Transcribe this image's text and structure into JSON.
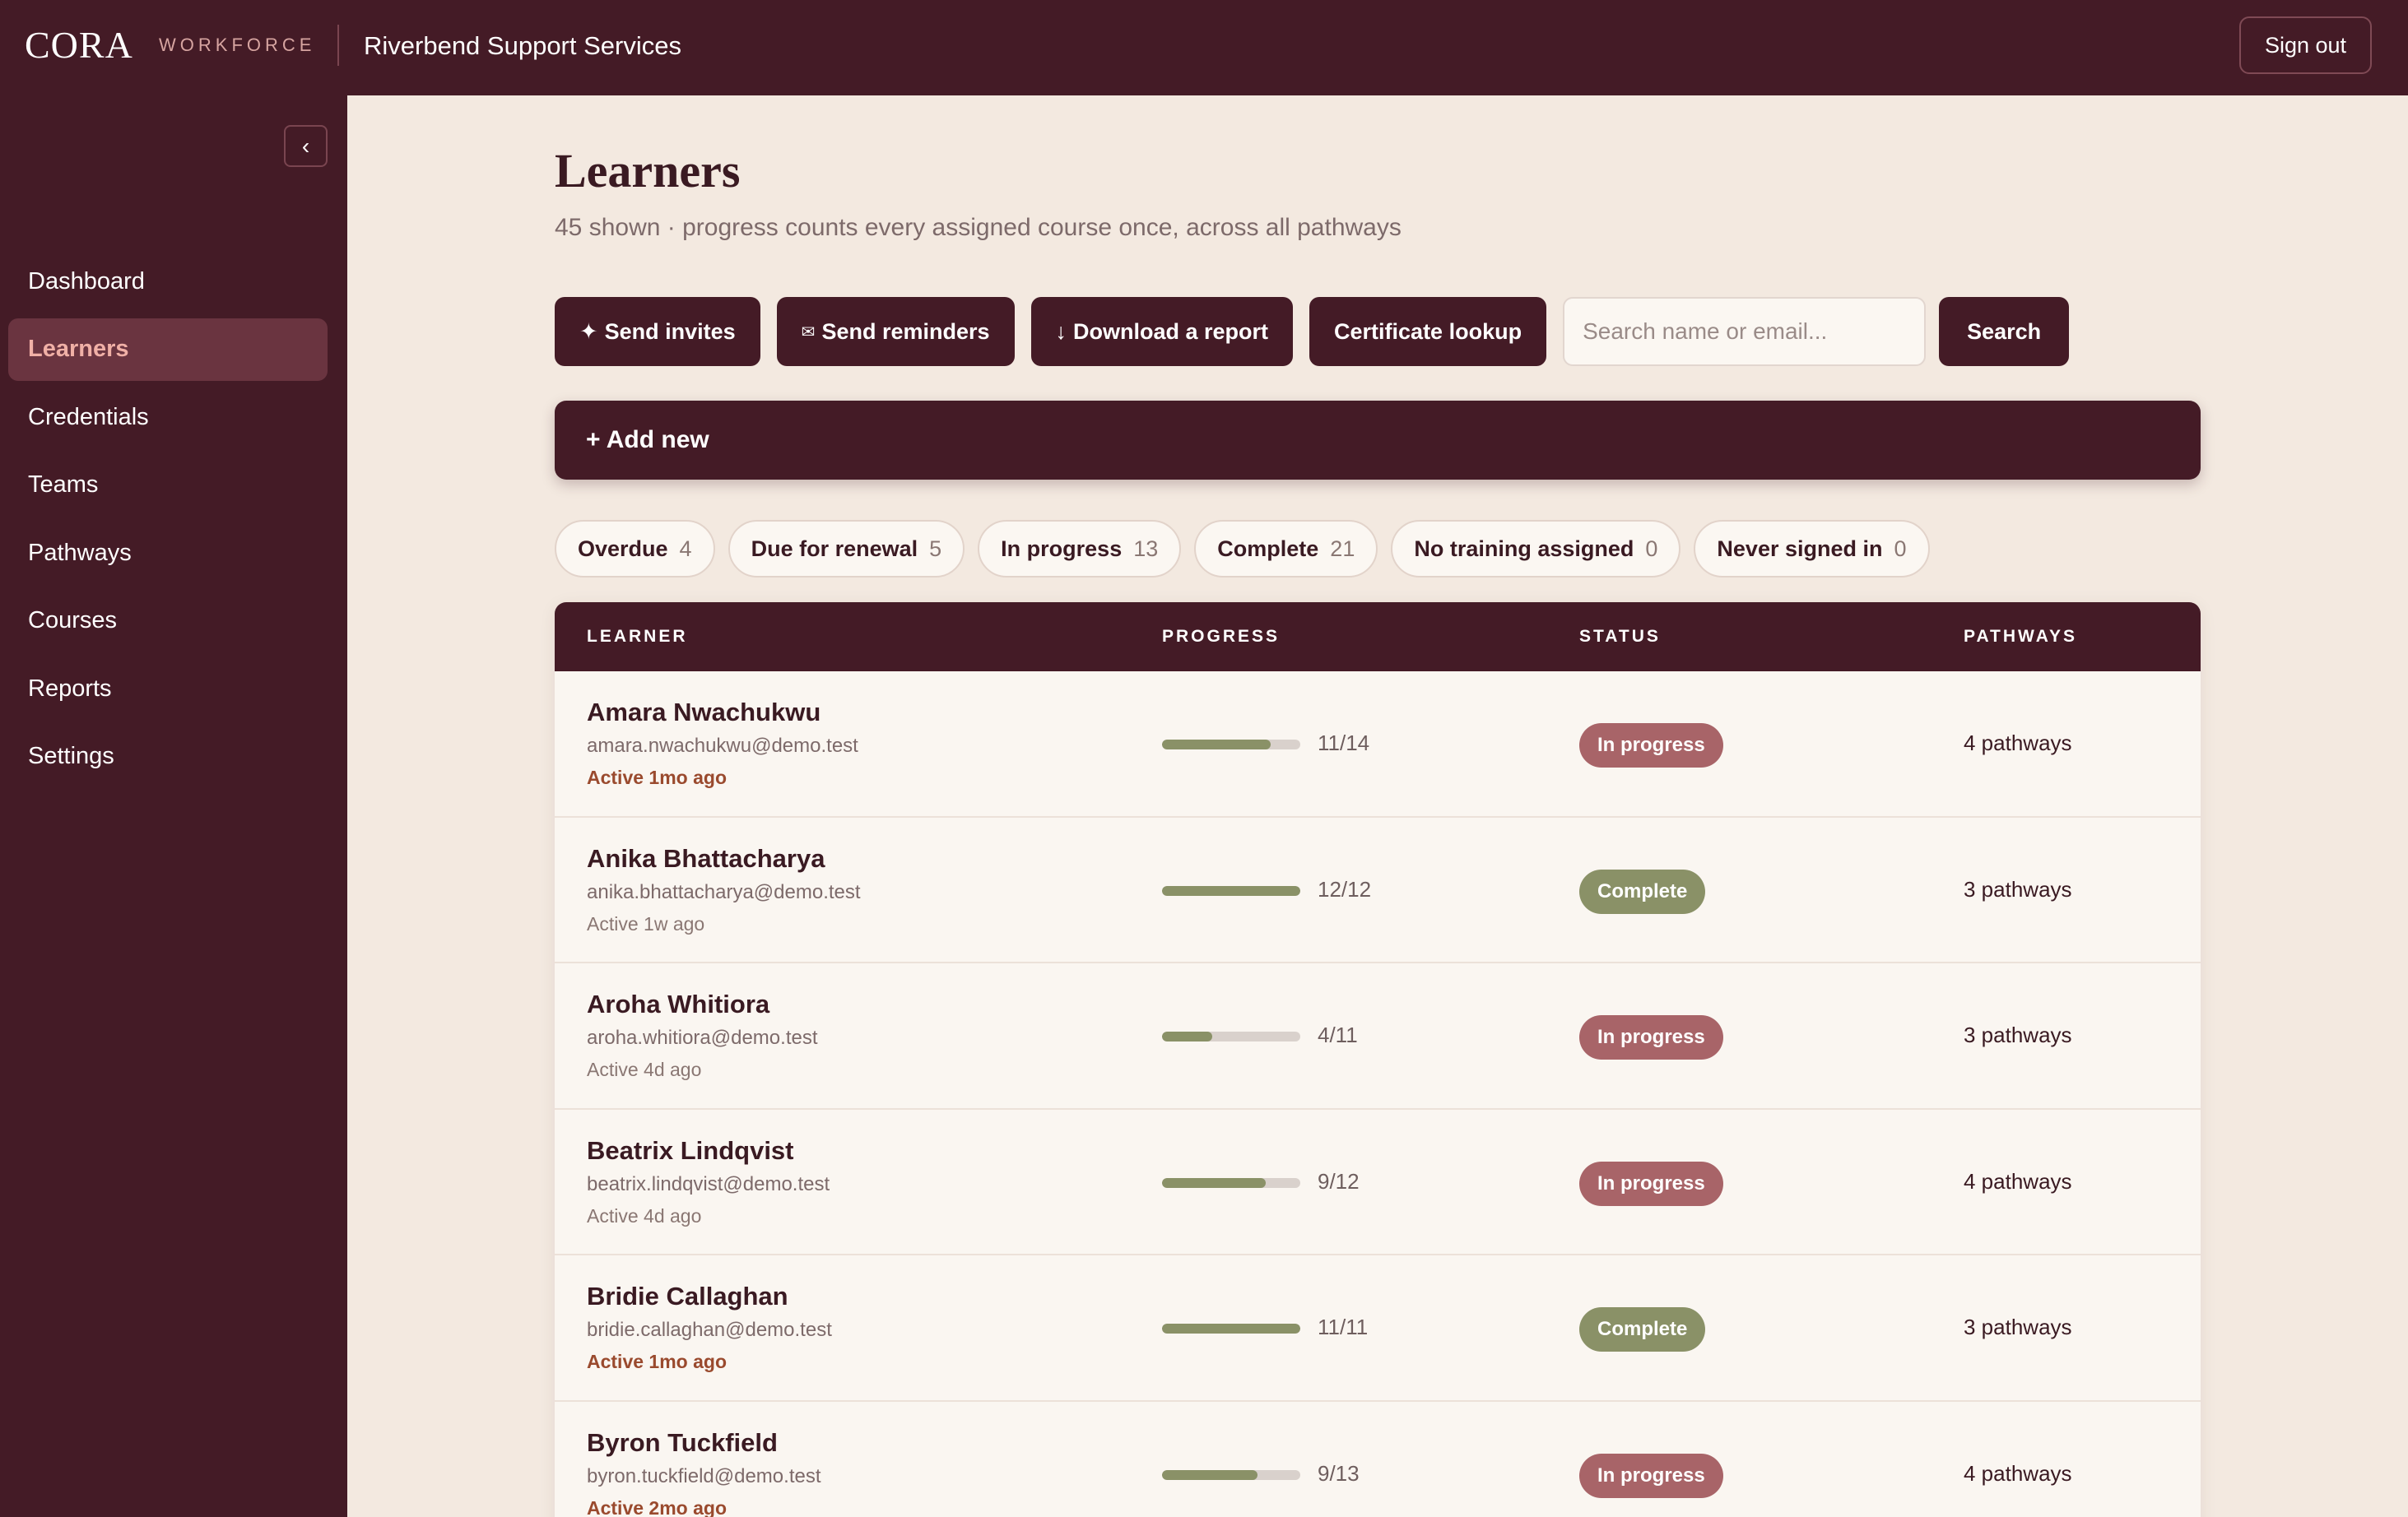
{
  "header": {
    "logo": "CORA",
    "logo_sub": "WORKFORCE",
    "org_name": "Riverbend Support Services",
    "signout_label": "Sign out"
  },
  "sidebar": {
    "collapse_label": "‹",
    "items": [
      {
        "label": "Dashboard",
        "active": false
      },
      {
        "label": "Learners",
        "active": true
      },
      {
        "label": "Credentials",
        "active": false
      },
      {
        "label": "Teams",
        "active": false
      },
      {
        "label": "Pathways",
        "active": false
      },
      {
        "label": "Courses",
        "active": false
      },
      {
        "label": "Reports",
        "active": false
      },
      {
        "label": "Settings",
        "active": false
      }
    ]
  },
  "page": {
    "title": "Learners",
    "subtitle": "45 shown · progress counts every assigned course once, across all pathways"
  },
  "toolbar": {
    "send_invites_icon": "✦",
    "send_invites": "Send invites",
    "send_reminders_icon": "✉",
    "send_reminders": "Send reminders",
    "download_icon": "↓",
    "download": "Download a report",
    "certificate": "Certificate lookup",
    "search_placeholder": "Search name or email...",
    "search_button": "Search"
  },
  "add_new": "+ Add new",
  "filters": [
    {
      "label": "Overdue",
      "count": "4"
    },
    {
      "label": "Due for renewal",
      "count": "5"
    },
    {
      "label": "In progress",
      "count": "13"
    },
    {
      "label": "Complete",
      "count": "21"
    },
    {
      "label": "No training assigned",
      "count": "0"
    },
    {
      "label": "Never signed in",
      "count": "0"
    }
  ],
  "table": {
    "headers": [
      "LEARNER",
      "PROGRESS",
      "STATUS",
      "PATHWAYS"
    ],
    "rows": [
      {
        "name": "Amara Nwachukwu",
        "email": "amara.nwachukwu@demo.test",
        "active": "Active 1mo ago",
        "stale": true,
        "done": 11,
        "total": 14,
        "progress": "11/14",
        "status": "In progress",
        "pathways": "4 pathways"
      },
      {
        "name": "Anika Bhattacharya",
        "email": "anika.bhattacharya@demo.test",
        "active": "Active 1w ago",
        "stale": false,
        "done": 12,
        "total": 12,
        "progress": "12/12",
        "status": "Complete",
        "pathways": "3 pathways"
      },
      {
        "name": "Aroha Whitiora",
        "email": "aroha.whitiora@demo.test",
        "active": "Active 4d ago",
        "stale": false,
        "done": 4,
        "total": 11,
        "progress": "4/11",
        "status": "In progress",
        "pathways": "3 pathways"
      },
      {
        "name": "Beatrix Lindqvist",
        "email": "beatrix.lindqvist@demo.test",
        "active": "Active 4d ago",
        "stale": false,
        "done": 9,
        "total": 12,
        "progress": "9/12",
        "status": "In progress",
        "pathways": "4 pathways"
      },
      {
        "name": "Bridie Callaghan",
        "email": "bridie.callaghan@demo.test",
        "active": "Active 1mo ago",
        "stale": true,
        "done": 11,
        "total": 11,
        "progress": "11/11",
        "status": "Complete",
        "pathways": "3 pathways"
      },
      {
        "name": "Byron Tuckfield",
        "email": "byron.tuckfield@demo.test",
        "active": "Active 2mo ago",
        "stale": true,
        "done": 9,
        "total": 13,
        "progress": "9/13",
        "status": "In progress",
        "pathways": "4 pathways"
      }
    ]
  }
}
